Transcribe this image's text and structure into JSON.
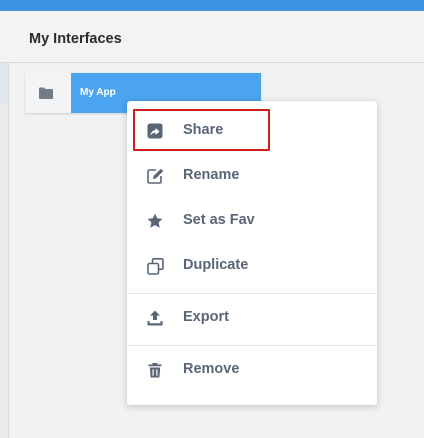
{
  "header": {
    "title": "My Interfaces"
  },
  "app_card": {
    "name": "My App",
    "icon": "folder-icon"
  },
  "context_menu": {
    "items": [
      {
        "label": "Share",
        "icon": "share-icon",
        "highlighted": true
      },
      {
        "label": "Rename",
        "icon": "edit-icon"
      },
      {
        "label": "Set as Fav",
        "icon": "star-icon"
      },
      {
        "label": "Duplicate",
        "icon": "duplicate-icon"
      },
      {
        "label": "Export",
        "icon": "export-icon"
      },
      {
        "label": "Remove",
        "icon": "trash-icon"
      }
    ]
  },
  "colors": {
    "accent": "#3d92e4",
    "card": "#4aa4ef",
    "highlight": "#d01e1e",
    "menu_text": "#5a6678"
  }
}
